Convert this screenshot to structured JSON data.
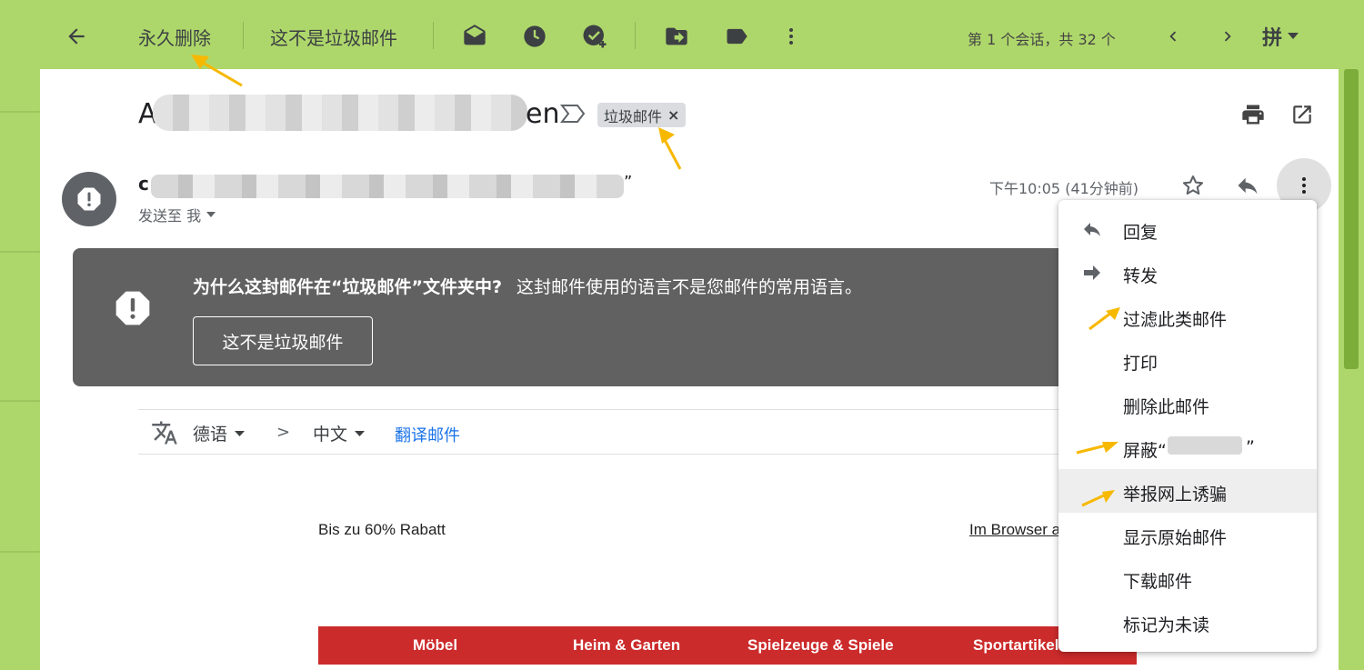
{
  "toolbar": {
    "delete_forever": "永久删除",
    "not_spam": "这不是垃圾邮件",
    "conversation_count": "第 1 个会话，共 32 个",
    "input_method": "拼"
  },
  "subject": {
    "visible_start": "A",
    "visible_end": "en",
    "label_chip": "垃圾邮件",
    "chip_close": "×"
  },
  "message": {
    "sender_initial": "c",
    "sender_suffix": "”",
    "send_to": "发送至 我",
    "time": "下午10:05 (41分钟前)"
  },
  "banner": {
    "title": "为什么这封邮件在“垃圾邮件”文件夹中?",
    "reason": "这封邮件使用的语言不是您邮件的常用语言。",
    "button": "这不是垃圾邮件"
  },
  "translate": {
    "source_lang": "德语",
    "arrow": ">",
    "target_lang": "中文",
    "link": "翻译邮件"
  },
  "email_body": {
    "promo": "Bis zu 60% Rabatt",
    "browser_link": "Im Browser a",
    "categories": [
      "Möbel",
      "Heim & Garten",
      "Spielzeuge & Spiele",
      "Sportartikel"
    ]
  },
  "menu": {
    "items": [
      {
        "label": "回复",
        "icon": "reply-icon"
      },
      {
        "label": "转发",
        "icon": "forward-icon"
      },
      {
        "label": "过滤此类邮件",
        "icon": ""
      },
      {
        "label": "打印",
        "icon": ""
      },
      {
        "label": "删除此邮件",
        "icon": ""
      },
      {
        "label": "屏蔽“",
        "suffix": "”",
        "icon": ""
      },
      {
        "label": "举报网上诱骗",
        "icon": ""
      },
      {
        "label": "显示原始邮件",
        "icon": ""
      },
      {
        "label": "下载邮件",
        "icon": ""
      },
      {
        "label": "标记为未读",
        "icon": ""
      }
    ]
  },
  "colors": {
    "background": "#aed76b",
    "banner": "#616161",
    "link": "#1a73e8",
    "category_bar": "#cc2b2b",
    "annotation_arrow": "#f7b800"
  }
}
